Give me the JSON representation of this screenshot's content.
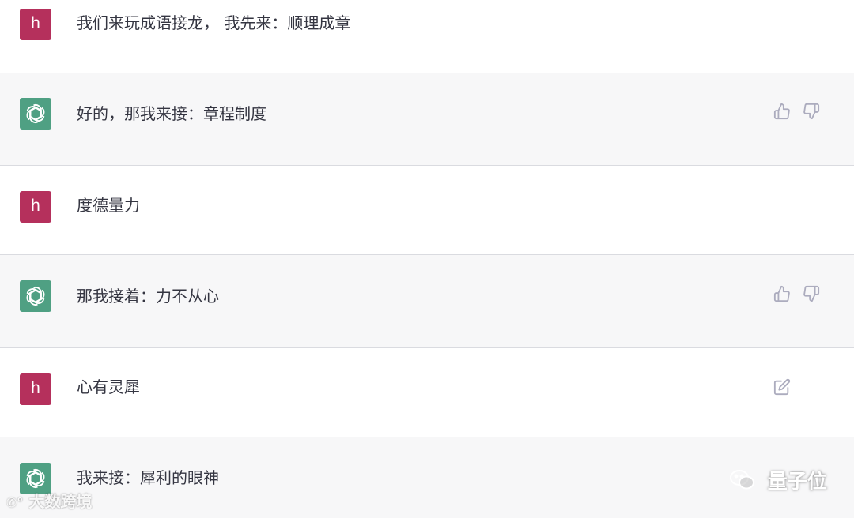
{
  "messages": [
    {
      "role": "user",
      "avatar_letter": "h",
      "text": "我们来玩成语接龙， 我先来：顺理成章"
    },
    {
      "role": "assistant",
      "avatar_icon": "openai-logo-icon",
      "text": "好的，那我来接：章程制度",
      "actions": [
        "thumbs-up-icon",
        "thumbs-down-icon"
      ]
    },
    {
      "role": "user",
      "avatar_letter": "h",
      "text": "度德量力"
    },
    {
      "role": "assistant",
      "avatar_icon": "openai-logo-icon",
      "text": "那我接着：力不从心",
      "actions": [
        "thumbs-up-icon",
        "thumbs-down-icon"
      ]
    },
    {
      "role": "user",
      "avatar_letter": "h",
      "text": "心有灵犀",
      "actions": [
        "edit-icon"
      ]
    },
    {
      "role": "assistant",
      "avatar_icon": "openai-logo-icon",
      "text": "我来接：犀利的眼神"
    }
  ],
  "watermarks": {
    "left": "大数跨境",
    "right": "量子位"
  },
  "colors": {
    "user_avatar": "#b5305c",
    "assistant_avatar": "#4fa083",
    "assistant_row": "#f7f7f8",
    "text": "#343541",
    "icon": "#acacbe"
  }
}
